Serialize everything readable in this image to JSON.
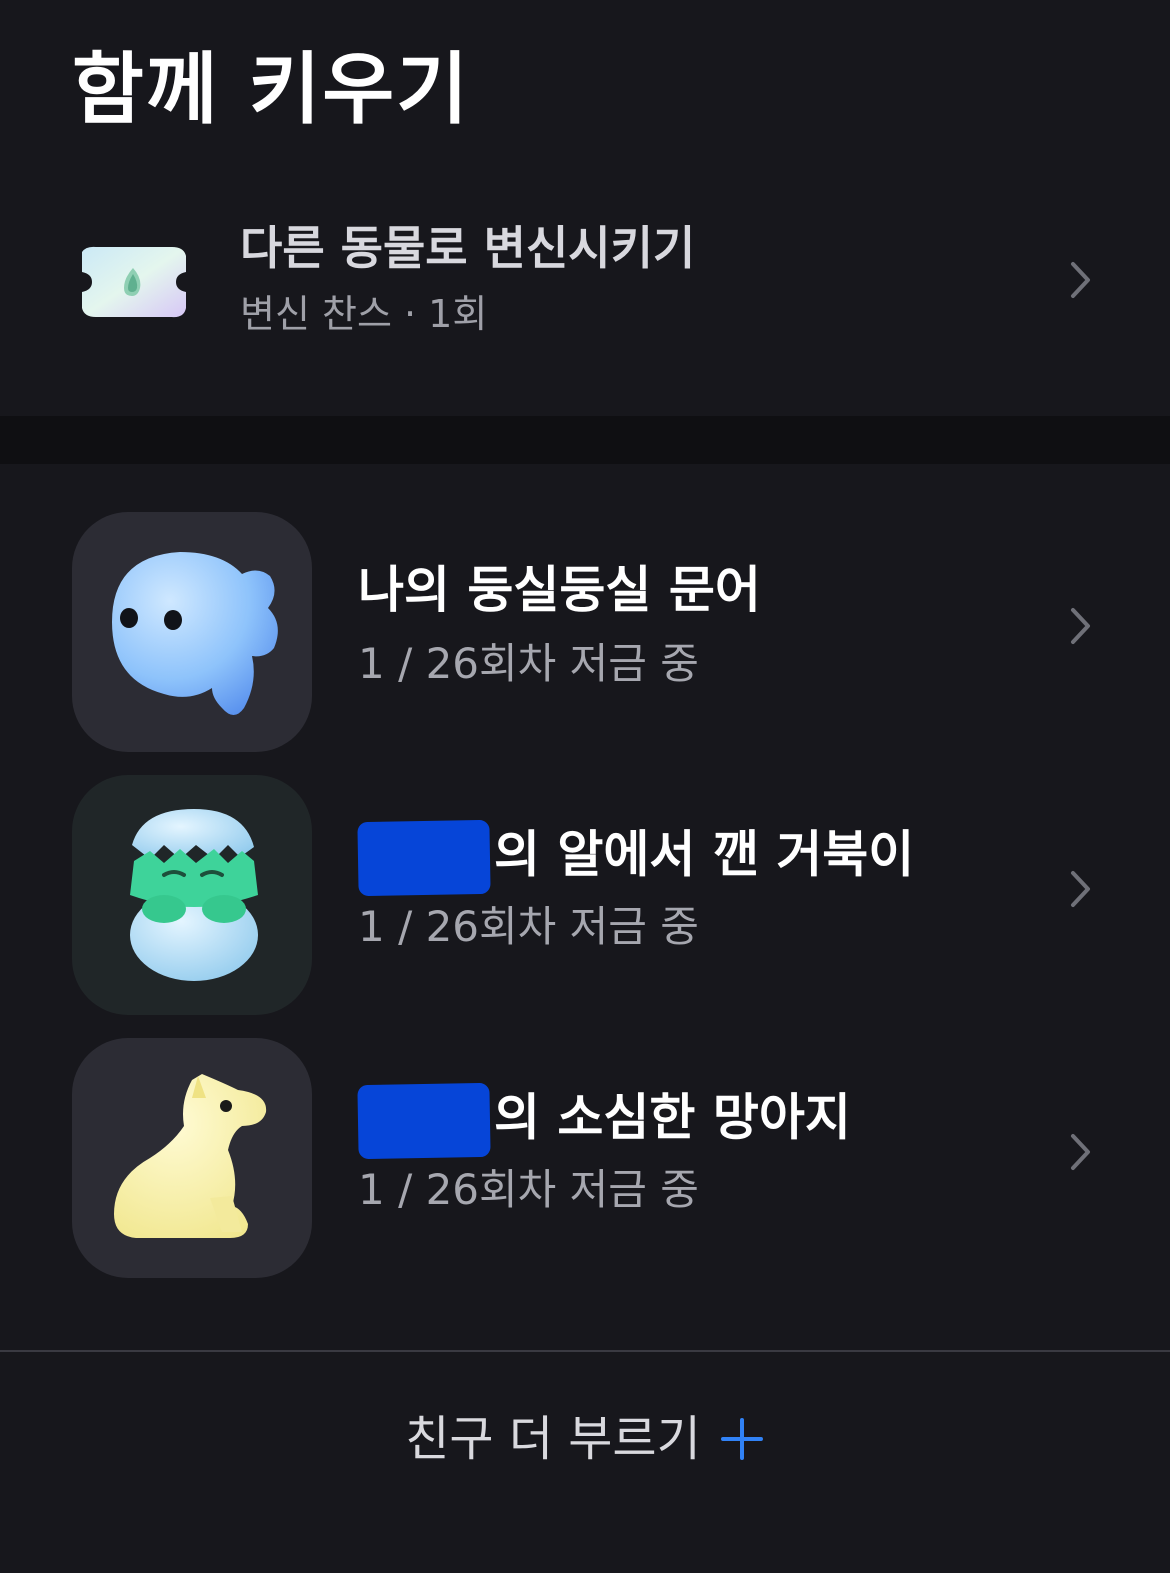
{
  "header": {
    "title": "함께 키우기"
  },
  "transform": {
    "title": "다른 동물로 변신시키기",
    "subtitle": "변신 찬스 · 1회",
    "icon": "ticket-icon"
  },
  "pets": [
    {
      "name_prefix": "",
      "name": "나의 둥실둥실 문어",
      "status": "1 / 26회차 저금 중",
      "icon": "octopus-icon",
      "owner_redacted": false
    },
    {
      "name_prefix": "",
      "name": "의 알에서 깬 거북이",
      "status": "1 / 26회차 저금 중",
      "icon": "hatching-turtle-icon",
      "owner_redacted": true
    },
    {
      "name_prefix": "",
      "name": "의 소심한 망아지",
      "status": "1 / 26회차 저금 중",
      "icon": "pony-icon",
      "owner_redacted": true
    }
  ],
  "footer": {
    "invite_label": "친구 더 부르기",
    "accent": "#3182f6"
  },
  "colors": {
    "background": "#17171c",
    "tile": "#2c2c34",
    "redaction": "#0645d8"
  }
}
